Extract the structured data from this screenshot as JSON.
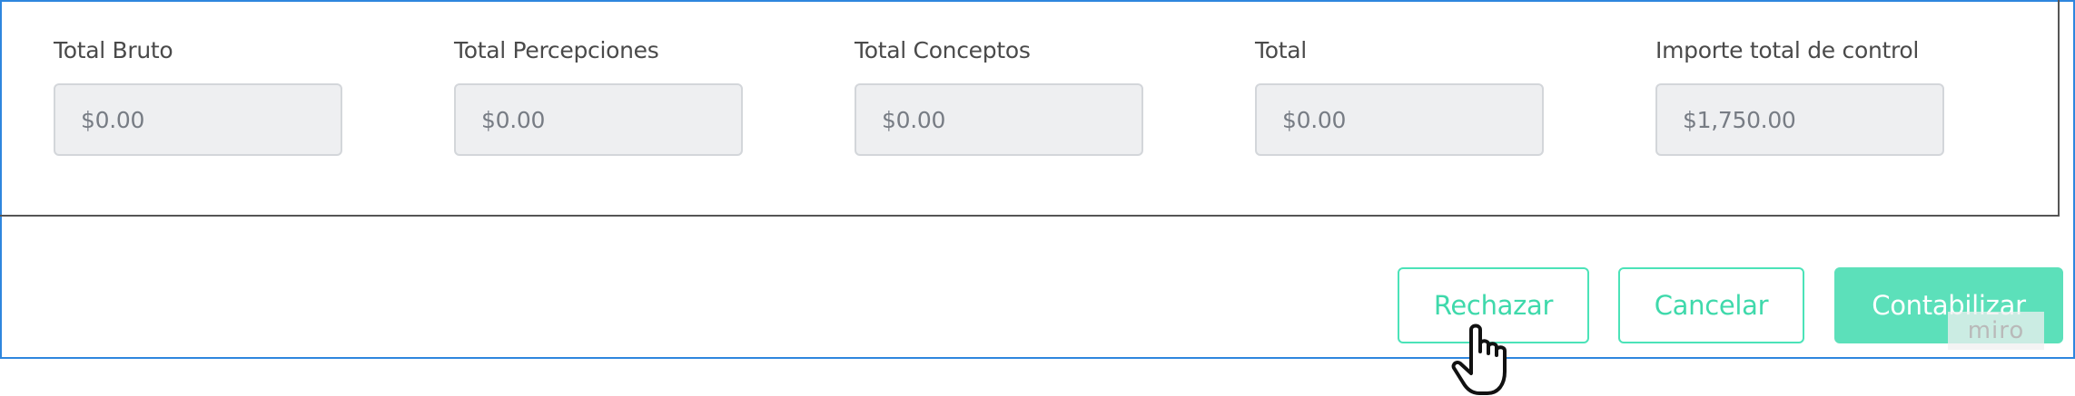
{
  "totals": {
    "fields": [
      {
        "label": "Total Bruto",
        "value": "$0.00"
      },
      {
        "label": "Total Percepciones",
        "value": "$0.00"
      },
      {
        "label": "Total Conceptos",
        "value": "$0.00"
      },
      {
        "label": "Total",
        "value": "$0.00"
      },
      {
        "label": "Importe total de control",
        "value": "$1,750.00"
      }
    ]
  },
  "actions": {
    "reject_label": "Rechazar",
    "cancel_label": "Cancelar",
    "post_label": "Contabilizar"
  },
  "watermark": {
    "text": "miro"
  },
  "cursor": {
    "icon": "hand-pointer-icon"
  },
  "colors": {
    "accent": "#4be3b8",
    "primary_fill": "#5ce0ba",
    "frame_border": "#2e86de",
    "input_bg": "#eeeff1"
  }
}
